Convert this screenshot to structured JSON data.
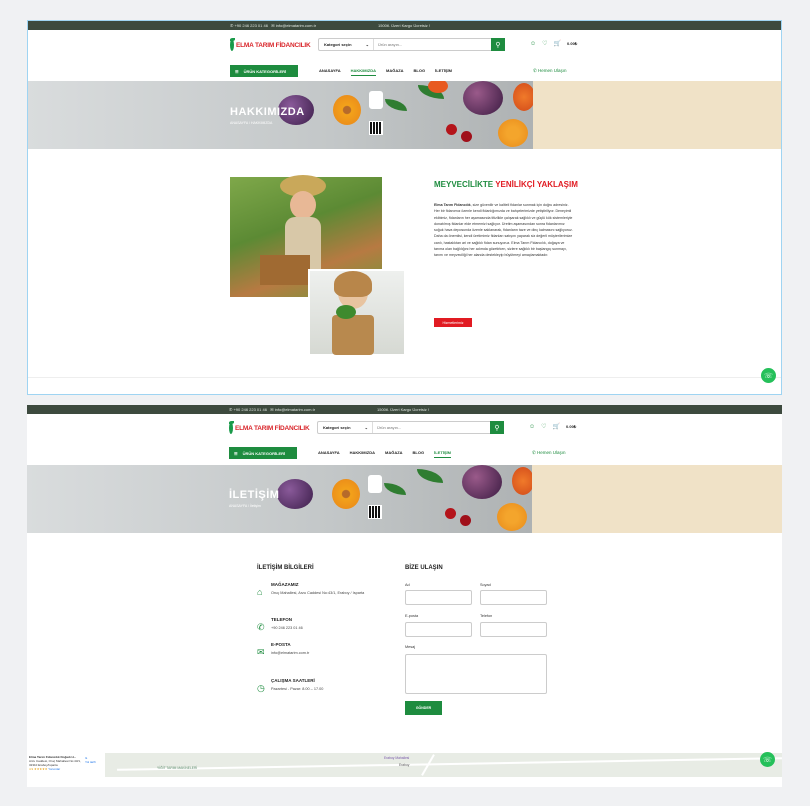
{
  "topbar": {
    "phone": "+90 246 223 01 46",
    "email": "info@elmatarim.com.tr",
    "promo": "1500tl. Üzeri Kargo Ücretsiz !"
  },
  "brand": {
    "name": "ELMA TARIM FİDANCILIK",
    "green": "#1e8c3f",
    "red": "#e11b22"
  },
  "search": {
    "category": "Kategori seçin",
    "placeholder": "Ürün arayın..."
  },
  "header": {
    "cart_total": "0.00₺"
  },
  "nav": {
    "categories_button": "ÜRÜN KATEGORİLERİ",
    "items": [
      "ANASAYFA",
      "HAKKIMIZDA",
      "MAĞAZA",
      "BLOG",
      "İLETİŞİM"
    ],
    "call_now": "Hemen Ulaşın"
  },
  "about_page": {
    "banner_title": "HAKKIMIZDA",
    "breadcrumb": "ANASAYFA / HAKKIMIZDA",
    "heading_part1": "MEYVECİLİKTE ",
    "heading_part2": "YENİLİKÇİ YAKLAŞIM",
    "body_bold": "Elma Tarım Fidancılık",
    "body": ", size güvenilir ve kaliteli fidanlar sunmak için doğru adresiniz. Her bir fidanımız özenle kendi fidanlığımızda ve bahçelerimizde yetiştiriliyor. Deneyimli ekibimiz, fidanların her aşamasında titizlikle çalışarak sağlıklı ve güçlü kök sistemleriyle donatılmış fidanlar elde etmemizi sağlıyor. Üretim aşamasından sonra fidanlarımız soğuk hava deposunda özenle saklanarak, fidanların taze ve dinç kalmasını sağlıyoruz. Daha da önemlisi, kendi üretimimiz fidanları satışını yaparak siz değerli müşterilerimize canlı, hastalıktan ari ve sağlıklı fidan sunuyoruz. Elma Tarım Fidancılık, doğaya ve tarıma olan bağlılığını her adımda gözetirken, sizlere sağlıklı bir başlangıç sunmayı, tarımı ve meyveciliği her alanda destekleyip büyütmeyi amaçlamaktadır.",
    "button": "Hizmetlerimiz"
  },
  "contact_page": {
    "banner_title": "İLETİŞİM",
    "breadcrumb": "ANASAYFA / İletişim",
    "info_title": "İLETİŞİM BİLGİLERİ",
    "items": [
      {
        "icon": "store-icon",
        "title": "MAĞAZAMIZ",
        "value": "Oruç Mahallesi, Arzu Caddesi No:43/1, Eraboy / Isparta"
      },
      {
        "icon": "phone-icon",
        "title": "TELEFON",
        "value": "+90 246 223 01 46"
      },
      {
        "icon": "mail-icon",
        "title": "E-POSTA",
        "value": "info@elmatarim.com.tr"
      },
      {
        "icon": "clock-icon",
        "title": "ÇALIŞMA SAATLERİ",
        "value": "Pazartesi - Pazar: 8.00 – 17.00"
      }
    ],
    "form_title": "BİZE ULAŞIN",
    "labels": {
      "name": "Ad",
      "surname": "Soyad",
      "email": "E-posta",
      "phone": "Telefon",
      "message": "Mesaj"
    },
    "submit": "GÖNDER"
  },
  "map": {
    "card_title": "Elma Tarım Fidancılık Doğadı H...",
    "card_address": "Arzu Caddesi, Oruç Mahallesi No:43/1, 32310 Eraboy/Isparta",
    "card_rating": "4.9",
    "card_reviews": "Yorumlar",
    "directions": "Yol tarifi",
    "label_store": "Eraboy Mahallesi",
    "label_place": "YİĞİT TARIM MAKİNELERİ",
    "label_town": "Eraboy"
  }
}
